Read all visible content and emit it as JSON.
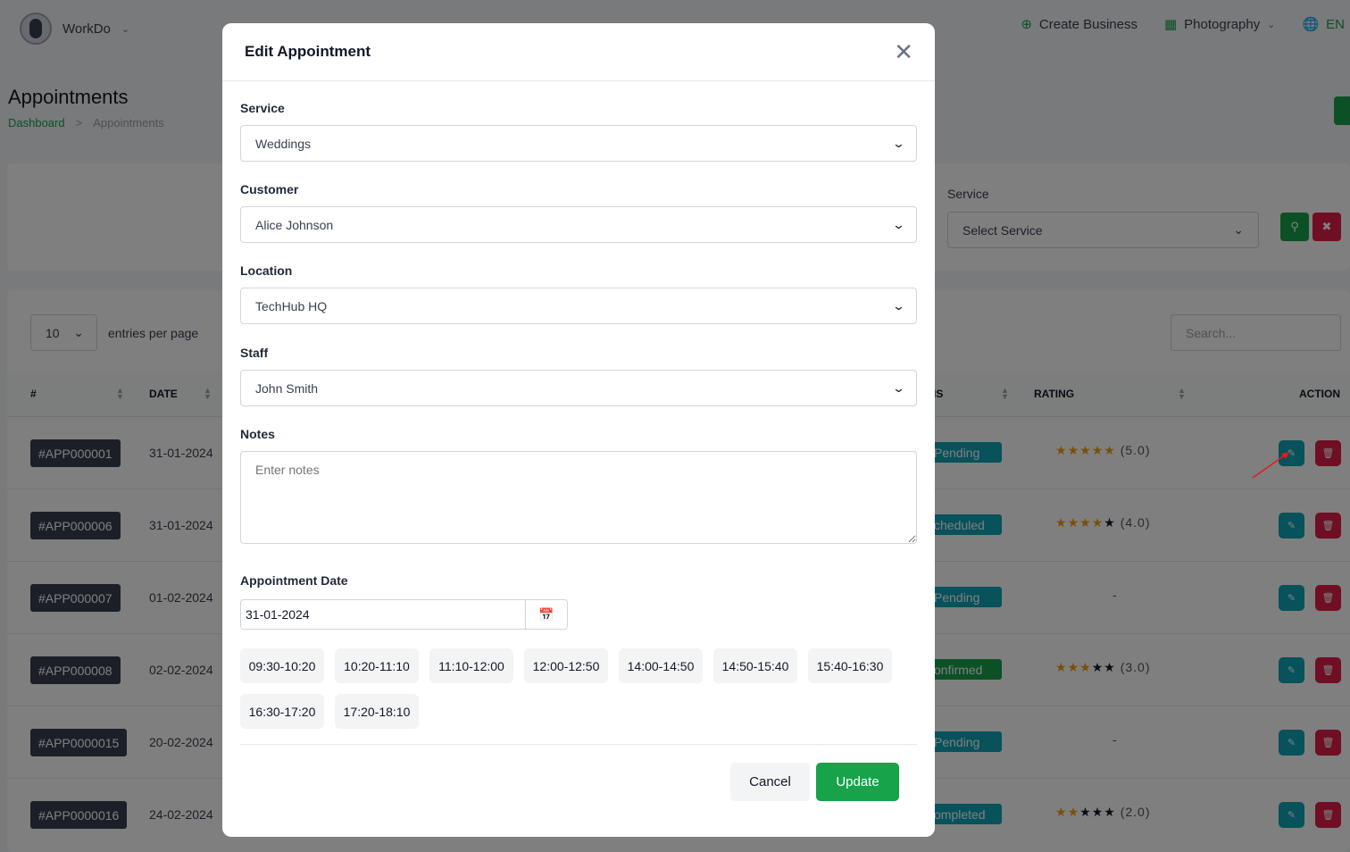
{
  "topbar": {
    "user_name": "WorkDo",
    "create_business": "Create Business",
    "workspace": "Photography",
    "language": "EN"
  },
  "page": {
    "title": "Appointments",
    "breadcrumb_home": "Dashboard",
    "breadcrumb_separator": ">",
    "breadcrumb_current": "Appointments"
  },
  "filters": {
    "service_label": "Service",
    "service_placeholder": "Select Service"
  },
  "table": {
    "entries_value": "10",
    "entries_label": "entries per page",
    "search_placeholder": "Search...",
    "headers": {
      "id": "#",
      "date": "DATE",
      "status": "IS",
      "rating": "RATING",
      "action": "ACTION"
    },
    "rows": [
      {
        "id": "#APP000001",
        "date": "31-01-2024",
        "status": "Pending",
        "status_color": "#0ea5b7",
        "rating_stars": 5,
        "rating_text": "(5.0)"
      },
      {
        "id": "#APP000006",
        "date": "31-01-2024",
        "status": "cheduled",
        "status_color": "#0ea5b7",
        "rating_stars": 4,
        "rating_text": "(4.0)"
      },
      {
        "id": "#APP000007",
        "date": "01-02-2024",
        "status": "Pending",
        "status_color": "#0ea5b7",
        "rating_stars": 0,
        "rating_text": "-"
      },
      {
        "id": "#APP000008",
        "date": "02-02-2024",
        "status": "onfirmed",
        "status_color": "#16a34a",
        "rating_stars": 3,
        "rating_text": "(3.0)"
      },
      {
        "id": "#APP0000015",
        "date": "20-02-2024",
        "status": "Pending",
        "status_color": "#0ea5b7",
        "rating_stars": 0,
        "rating_text": "-"
      },
      {
        "id": "#APP0000016",
        "date": "24-02-2024",
        "status": "ompleted",
        "status_color": "#0ea5b7",
        "rating_stars": 2,
        "rating_text": "(2.0)"
      }
    ]
  },
  "modal": {
    "title": "Edit Appointment",
    "service_label": "Service",
    "service_value": "Weddings",
    "customer_label": "Customer",
    "customer_value": "Alice Johnson",
    "location_label": "Location",
    "location_value": "TechHub HQ",
    "staff_label": "Staff",
    "staff_value": "John Smith",
    "notes_label": "Notes",
    "notes_placeholder": "Enter notes",
    "date_label": "Appointment Date",
    "date_value": "31-01-2024",
    "slots": [
      "09:30-10:20",
      "10:20-11:10",
      "11:10-12:00",
      "12:00-12:50",
      "14:00-14:50",
      "14:50-15:40",
      "15:40-16:30",
      "16:30-17:20",
      "17:20-18:10"
    ],
    "cancel_label": "Cancel",
    "update_label": "Update"
  },
  "colors": {
    "accent": "#16a34a",
    "edit": "#0ea5b7",
    "delete": "#e11d48",
    "star": "#f59e0b"
  }
}
